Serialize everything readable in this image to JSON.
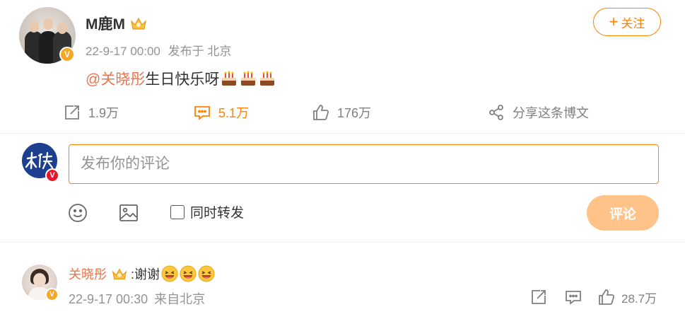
{
  "post": {
    "author": "M鹿M",
    "timestamp": "22-9-17 00:00",
    "source": "发布于 北京",
    "follow_label": "关注",
    "mention": "@关晓彤",
    "text": " 生日快乐呀",
    "emoji_icon": "birthday-cake-icon",
    "accent_color": "#ff8200",
    "mention_color": "#eb7350"
  },
  "actions": {
    "repost_count": "1.9万",
    "comment_count": "5.1万",
    "like_count": "176万",
    "share_label": "分享这条博文"
  },
  "composer": {
    "placeholder": "发布你的评论",
    "repost_label": "同时转发",
    "submit_label": "评论"
  },
  "reply": {
    "author": "关晓彤",
    "text": ":谢谢",
    "emoji_icon": "laughing-face-icon",
    "timestamp": "22-9-17 00:30",
    "source": "来自北京",
    "like_count": "28.7万"
  }
}
